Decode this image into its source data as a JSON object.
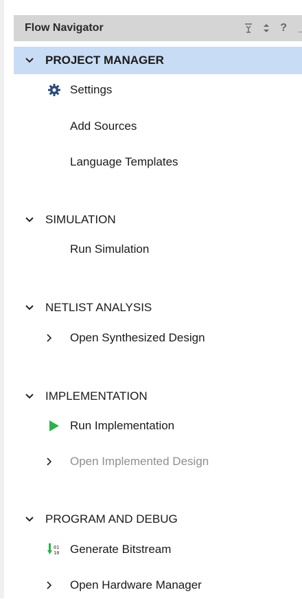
{
  "header": {
    "title": "Flow Navigator",
    "buttons": [
      {
        "name": "collapse-all-icon",
        "glyph": "⇟"
      },
      {
        "name": "expand-all-icon",
        "glyph": "⇕"
      },
      {
        "name": "help-icon",
        "glyph": "?"
      },
      {
        "name": "minimize-icon",
        "glyph": "_"
      }
    ]
  },
  "sections": [
    {
      "label": "PROJECT MANAGER",
      "selected": true,
      "items": [
        {
          "label": "Settings",
          "icon": "gear-icon"
        },
        {
          "label": "Add Sources",
          "icon": "none"
        },
        {
          "label": "Language Templates",
          "icon": "none"
        }
      ]
    },
    {
      "label": "SIMULATION",
      "items": [
        {
          "label": "Run Simulation",
          "icon": "none"
        }
      ]
    },
    {
      "label": "NETLIST ANALYSIS",
      "items": [
        {
          "label": "Open Synthesized Design",
          "icon": "expand-chevron"
        }
      ]
    },
    {
      "label": "IMPLEMENTATION",
      "items": [
        {
          "label": "Run Implementation",
          "icon": "run-play-icon"
        },
        {
          "label": "Open Implemented Design",
          "icon": "expand-chevron",
          "disabled": true
        }
      ]
    },
    {
      "label": "PROGRAM AND DEBUG",
      "items": [
        {
          "label": "Generate Bitstream",
          "icon": "bitstream-icon"
        },
        {
          "label": "Open Hardware Manager",
          "icon": "expand-chevron"
        }
      ]
    }
  ],
  "colors": {
    "header_bg": "#d5d5d5",
    "selected_bg": "#c9dcf5",
    "gear": "#2b4a7a",
    "play": "#2bb34a",
    "disabled_text": "#8f8f8f"
  }
}
